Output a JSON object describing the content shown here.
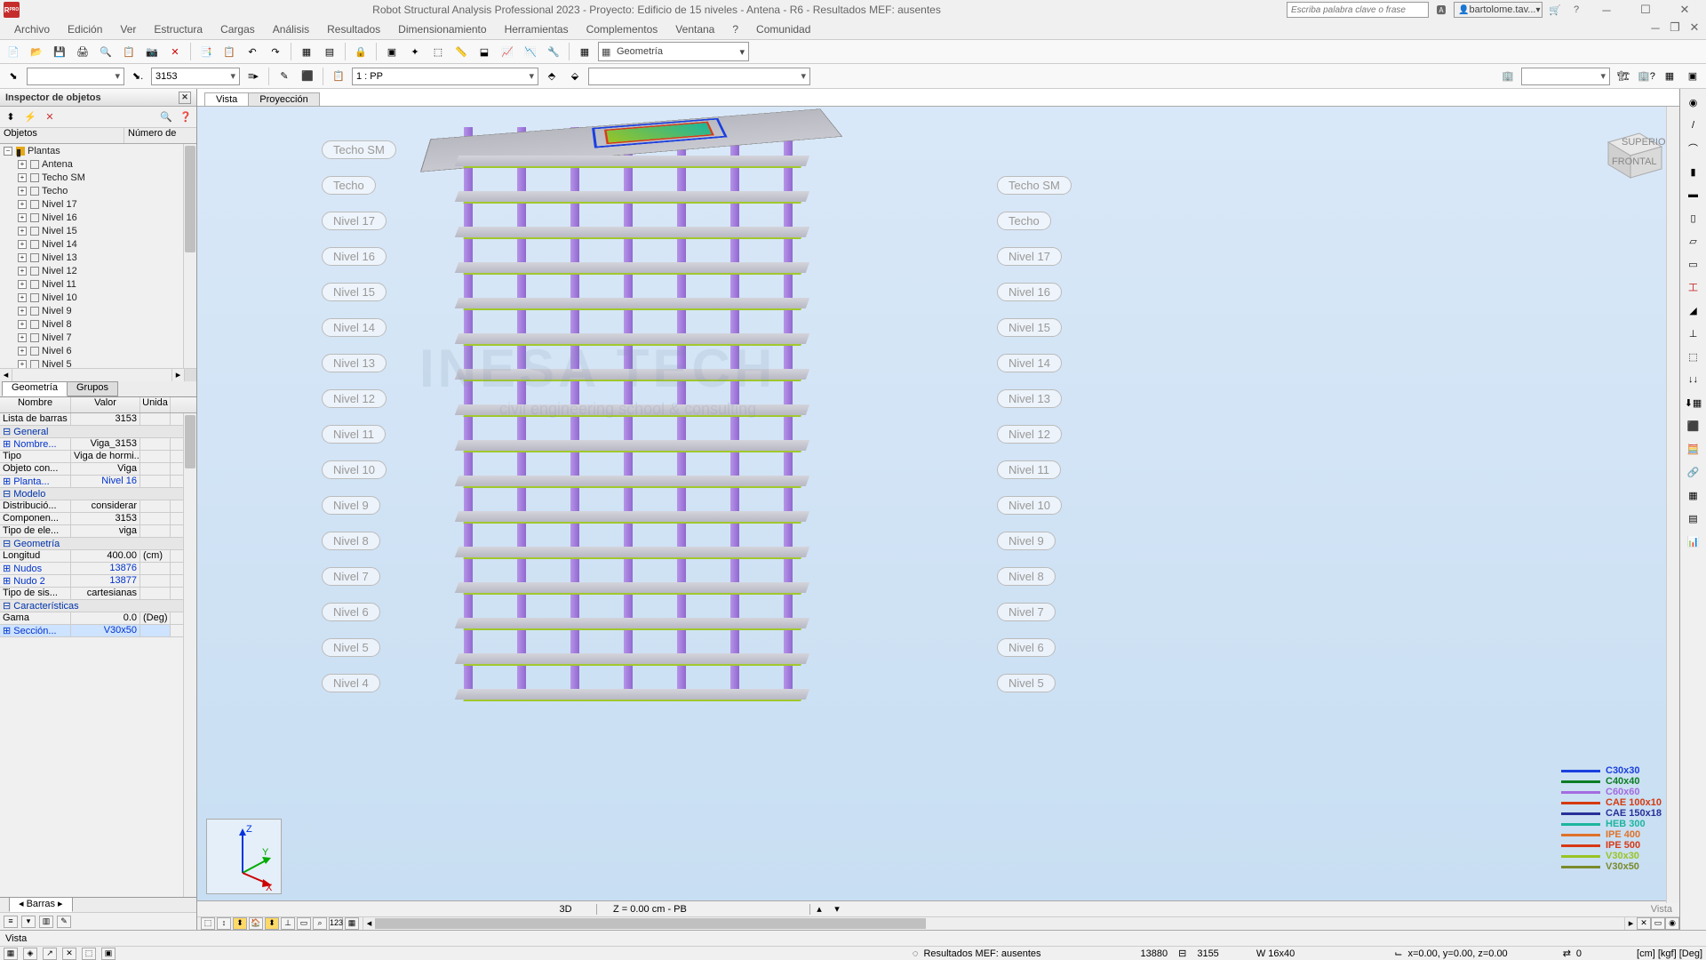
{
  "title": "Robot Structural Analysis Professional 2023 - Proyecto: Edificio de 15 niveles - Antena - R6 - Resultados MEF: ausentes",
  "search_placeholder": "Escriba palabra clave o frase",
  "user": "bartolome.tav...",
  "menu": [
    "Archivo",
    "Edición",
    "Ver",
    "Estructura",
    "Cargas",
    "Análisis",
    "Resultados",
    "Dimensionamiento",
    "Herramientas",
    "Complementos",
    "Ventana",
    "?",
    "Comunidad"
  ],
  "layout_combo": "Geometría",
  "node_input": "3153",
  "load_case": "1 : PP",
  "inspector": {
    "title": "Inspector de objetos",
    "cols": [
      "Objetos",
      "Número de"
    ],
    "root": "Plantas",
    "items": [
      "Antena",
      "Techo SM",
      "Techo",
      "Nivel 17",
      "Nivel 16",
      "Nivel 15",
      "Nivel 14",
      "Nivel 13",
      "Nivel 12",
      "Nivel 11",
      "Nivel 10",
      "Nivel 9",
      "Nivel 8",
      "Nivel 7",
      "Nivel 6",
      "Nivel 5"
    ]
  },
  "prop_tabs": [
    "Geometría",
    "Grupos"
  ],
  "prop_head": [
    "Nombre",
    "Valor",
    "Unida"
  ],
  "props": [
    {
      "t": "r",
      "n": "Lista de barras",
      "v": "3153",
      "u": ""
    },
    {
      "t": "g",
      "n": "General"
    },
    {
      "t": "r",
      "n": "Nombre...",
      "v": "Viga_3153",
      "u": "",
      "link": true
    },
    {
      "t": "r",
      "n": "Tipo",
      "v": "Viga de hormi...",
      "u": ""
    },
    {
      "t": "r",
      "n": "Objeto con...",
      "v": "Viga",
      "u": ""
    },
    {
      "t": "r",
      "n": "Planta...",
      "v": "Nivel 16",
      "u": "",
      "link": true,
      "vlink": true
    },
    {
      "t": "g",
      "n": "Modelo"
    },
    {
      "t": "r",
      "n": "Distribució...",
      "v": "considerar",
      "u": ""
    },
    {
      "t": "r",
      "n": "Componen...",
      "v": "3153",
      "u": ""
    },
    {
      "t": "r",
      "n": "Tipo de ele...",
      "v": "viga",
      "u": ""
    },
    {
      "t": "g",
      "n": "Geometría"
    },
    {
      "t": "r",
      "n": "Longitud",
      "v": "400.00",
      "u": "(cm)"
    },
    {
      "t": "r",
      "n": "Nudos",
      "v": "13876",
      "u": "",
      "link": true,
      "vlink": true
    },
    {
      "t": "r",
      "n": "Nudo 2",
      "v": "13877",
      "u": "",
      "link": true,
      "vlink": true
    },
    {
      "t": "r",
      "n": "Tipo de sis...",
      "v": "cartesianas",
      "u": ""
    },
    {
      "t": "g",
      "n": "Características"
    },
    {
      "t": "r",
      "n": "Gama",
      "v": "0.0",
      "u": "(Deg)"
    },
    {
      "t": "r",
      "n": "Sección...",
      "v": "V30x50",
      "u": "",
      "link": true,
      "vlink": true,
      "hl": true
    }
  ],
  "barras_tab": "Barras",
  "view_tabs": [
    "Vista",
    "Proyección"
  ],
  "levels_left": [
    "Techo SM",
    "Techo",
    "Nivel 17",
    "Nivel 16",
    "Nivel 15",
    "Nivel 14",
    "Nivel 13",
    "Nivel 12",
    "Nivel 11",
    "Nivel 10",
    "Nivel 9",
    "Nivel 8",
    "Nivel 7",
    "Nivel 6",
    "Nivel 5",
    "Nivel 4"
  ],
  "levels_right": [
    "Techo SM",
    "Techo",
    "Nivel 17",
    "Nivel 16",
    "Nivel 15",
    "Nivel 14",
    "Nivel 13",
    "Nivel 12",
    "Nivel 11",
    "Nivel 10",
    "Nivel 9",
    "Nivel 8",
    "Nivel 7",
    "Nivel 6",
    "Nivel 5"
  ],
  "legend": [
    {
      "c": "#1a3fe0",
      "n": "C30x30"
    },
    {
      "c": "#0a7d24",
      "n": "C40x40"
    },
    {
      "c": "#a46be0",
      "n": "C60x60"
    },
    {
      "c": "#d43a0f",
      "n": "CAE 100x10"
    },
    {
      "c": "#2a2f99",
      "n": "CAE 150x18"
    },
    {
      "c": "#1bb59e",
      "n": "HEB 300"
    },
    {
      "c": "#e0722a",
      "n": "IPE 400"
    },
    {
      "c": "#d83815",
      "n": "IPE 500"
    },
    {
      "c": "#9ac425",
      "n": "V30x30"
    },
    {
      "c": "#7a8a2a",
      "n": "V30x50"
    }
  ],
  "view3d": "3D",
  "z_info": "Z = 0.00 cm - PB",
  "vista_label": "Vista",
  "status": {
    "analysis": "Resultados MEF: ausentes",
    "node": "13880",
    "bar": "3155",
    "section": "W 16x40",
    "coords": "x=0.00, y=0.00, z=0.00",
    "offset": "0",
    "units": "[cm] [kgf] [Deg]"
  },
  "vista_status": "Vista"
}
